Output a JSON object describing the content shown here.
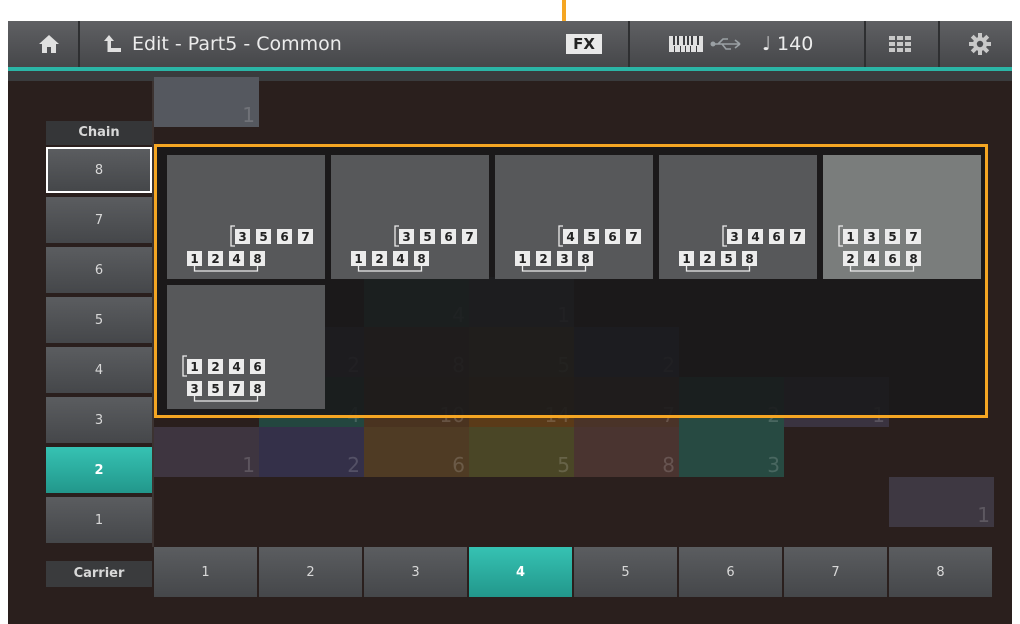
{
  "header": {
    "title": "Edit - Part5 - Common",
    "fx_label": "FX",
    "tempo": "140",
    "tempo_note": "♩"
  },
  "chain": {
    "label": "Chain",
    "buttons": [
      "8",
      "7",
      "6",
      "5",
      "4",
      "3",
      "2",
      "1"
    ],
    "active": "2",
    "selected": "8"
  },
  "carrier": {
    "label": "Carrier",
    "buttons": [
      "1",
      "2",
      "3",
      "4",
      "5",
      "6",
      "7",
      "8"
    ],
    "active": "4"
  },
  "grid_cells": [
    {
      "label": "1",
      "color": "#55585f"
    },
    {
      "label": "1",
      "color": "#34514a"
    },
    {
      "label": "1",
      "color": "#3d3945"
    },
    {
      "label": "4",
      "color": "#2e4b45"
    },
    {
      "label": "1",
      "color": "#3f3842"
    },
    {
      "label": "2",
      "color": "#3b3446"
    },
    {
      "label": "8",
      "color": "#4a342e"
    },
    {
      "label": "5",
      "color": "#53452a"
    },
    {
      "label": "2",
      "color": "#363249"
    },
    {
      "label": "4",
      "color": "#23463f"
    },
    {
      "label": "10",
      "color": "#4a3320"
    },
    {
      "label": "14",
      "color": "#5a3a18"
    },
    {
      "label": "7",
      "color": "#4a3328"
    },
    {
      "label": "2",
      "color": "#274a42"
    },
    {
      "label": "1",
      "color": "#3a3340"
    },
    {
      "label": "1",
      "color": "#3e3540"
    },
    {
      "label": "2",
      "color": "#343049"
    },
    {
      "label": "6",
      "color": "#4f3b24"
    },
    {
      "label": "5",
      "color": "#4a4626"
    },
    {
      "label": "8",
      "color": "#4a3430"
    },
    {
      "label": "3",
      "color": "#274a42"
    },
    {
      "label": "1",
      "color": "#3e3842"
    }
  ],
  "algorithms": [
    {
      "id": "1",
      "rows": [
        [
          "3",
          "5",
          "6",
          "7"
        ],
        [
          "1",
          "2",
          "4",
          "8"
        ]
      ]
    },
    {
      "id": "2",
      "rows": [
        [
          "3",
          "5",
          "6",
          "7"
        ],
        [
          "1",
          "2",
          "4",
          "8"
        ]
      ]
    },
    {
      "id": "3",
      "rows": [
        [
          "4",
          "5",
          "6",
          "7"
        ],
        [
          "1",
          "2",
          "3",
          "8"
        ]
      ]
    },
    {
      "id": "4",
      "rows": [
        [
          "3",
          "4",
          "6",
          "7"
        ],
        [
          "1",
          "2",
          "5",
          "8"
        ]
      ]
    },
    {
      "id": "5",
      "rows": [
        [
          "1",
          "3",
          "5",
          "7"
        ],
        [
          "2",
          "4",
          "6",
          "8"
        ]
      ]
    },
    {
      "id": "6",
      "rows": [
        [
          "1",
          "2",
          "4",
          "6"
        ],
        [
          "3",
          "5",
          "7",
          "8"
        ]
      ]
    }
  ],
  "selected_algorithm": "5",
  "colors": {
    "accent": "#2bb5a6",
    "highlight": "#f5a623"
  }
}
